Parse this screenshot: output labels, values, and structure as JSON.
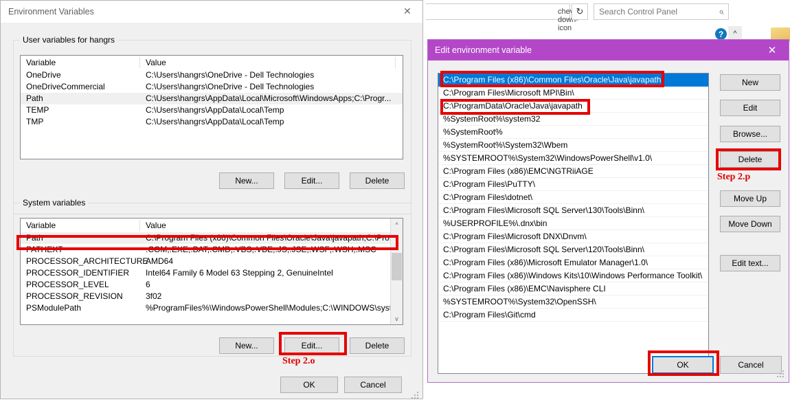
{
  "control_panel": {
    "address_chevron_icon": "chevron-down-icon",
    "refresh_icon": "↻",
    "search_placeholder": "Search Control Panel",
    "search_icon": "⌕",
    "help_icon": "?",
    "expander_icon": "^"
  },
  "env_window": {
    "title": "Environment Variables",
    "close_icon": "✕",
    "user_section": {
      "legend": "User variables for hangrs",
      "columns": [
        "Variable",
        "Value"
      ],
      "rows": [
        {
          "variable": "OneDrive",
          "value": "C:\\Users\\hangrs\\OneDrive - Dell Technologies",
          "selected": false
        },
        {
          "variable": "OneDriveCommercial",
          "value": "C:\\Users\\hangrs\\OneDrive - Dell Technologies",
          "selected": false
        },
        {
          "variable": "Path",
          "value": "C:\\Users\\hangrs\\AppData\\Local\\Microsoft\\WindowsApps;C:\\Progr...",
          "selected": true
        },
        {
          "variable": "TEMP",
          "value": "C:\\Users\\hangrs\\AppData\\Local\\Temp",
          "selected": false
        },
        {
          "variable": "TMP",
          "value": "C:\\Users\\hangrs\\AppData\\Local\\Temp",
          "selected": false
        }
      ],
      "buttons": {
        "new": "New...",
        "edit": "Edit...",
        "delete": "Delete"
      }
    },
    "system_section": {
      "legend": "System variables",
      "columns": [
        "Variable",
        "Value"
      ],
      "rows": [
        {
          "variable": "Path",
          "value": "C:\\Program Files (x86)\\Common Files\\Oracle\\Java\\javapath;C:\\Pro...",
          "selected": true
        },
        {
          "variable": "PATHEXT",
          "value": ".COM;.EXE;.BAT;.CMD;.VBS;.VBE;.JS;.JSE;.WSF;.WSH;.MSC",
          "selected": false
        },
        {
          "variable": "PROCESSOR_ARCHITECTURE",
          "value": "AMD64",
          "selected": false
        },
        {
          "variable": "PROCESSOR_IDENTIFIER",
          "value": "Intel64 Family 6 Model 63 Stepping 2, GenuineIntel",
          "selected": false
        },
        {
          "variable": "PROCESSOR_LEVEL",
          "value": "6",
          "selected": false
        },
        {
          "variable": "PROCESSOR_REVISION",
          "value": "3f02",
          "selected": false
        },
        {
          "variable": "PSModulePath",
          "value": "%ProgramFiles%\\WindowsPowerShell\\Modules;C:\\WINDOWS\\syst...",
          "selected": false
        }
      ],
      "buttons": {
        "new": "New...",
        "edit": "Edit...",
        "delete": "Delete"
      },
      "scroll_up_icon": "^",
      "scroll_down_icon": "v"
    },
    "footer": {
      "ok": "OK",
      "cancel": "Cancel"
    }
  },
  "edit_window": {
    "title": "Edit environment variable",
    "close_icon": "✕",
    "path_entries": [
      {
        "text": "C:\\Program Files (x86)\\Common Files\\Oracle\\Java\\javapath",
        "selected": true
      },
      {
        "text": "C:\\Program Files\\Microsoft MPI\\Bin\\",
        "selected": false
      },
      {
        "text": "C:\\ProgramData\\Oracle\\Java\\javapath",
        "selected": false
      },
      {
        "text": "%SystemRoot%\\system32",
        "selected": false
      },
      {
        "text": "%SystemRoot%",
        "selected": false
      },
      {
        "text": "%SystemRoot%\\System32\\Wbem",
        "selected": false
      },
      {
        "text": "%SYSTEMROOT%\\System32\\WindowsPowerShell\\v1.0\\",
        "selected": false
      },
      {
        "text": "C:\\Program Files (x86)\\EMC\\NGTRiiAGE",
        "selected": false
      },
      {
        "text": "C:\\Program Files\\PuTTY\\",
        "selected": false
      },
      {
        "text": "C:\\Program Files\\dotnet\\",
        "selected": false
      },
      {
        "text": "C:\\Program Files\\Microsoft SQL Server\\130\\Tools\\Binn\\",
        "selected": false
      },
      {
        "text": "%USERPROFILE%\\.dnx\\bin",
        "selected": false
      },
      {
        "text": "C:\\Program Files\\Microsoft DNX\\Dnvm\\",
        "selected": false
      },
      {
        "text": "C:\\Program Files\\Microsoft SQL Server\\120\\Tools\\Binn\\",
        "selected": false
      },
      {
        "text": "C:\\Program Files (x86)\\Microsoft Emulator Manager\\1.0\\",
        "selected": false
      },
      {
        "text": "C:\\Program Files (x86)\\Windows Kits\\10\\Windows Performance Toolkit\\",
        "selected": false
      },
      {
        "text": "C:\\Program Files (x86)\\EMC\\Navisphere CLI",
        "selected": false
      },
      {
        "text": "%SYSTEMROOT%\\System32\\OpenSSH\\",
        "selected": false
      },
      {
        "text": "C:\\Program Files\\Git\\cmd",
        "selected": false
      }
    ],
    "side_buttons": {
      "new": "New",
      "edit": "Edit",
      "browse": "Browse...",
      "delete": "Delete",
      "move_up": "Move Up",
      "move_down": "Move Down",
      "edit_text": "Edit text..."
    },
    "footer": {
      "ok": "OK",
      "cancel": "Cancel"
    }
  },
  "annotations": {
    "step_2o": "Step 2.o",
    "step_2p": "Step 2.p",
    "highlight_color": "#e60000"
  }
}
